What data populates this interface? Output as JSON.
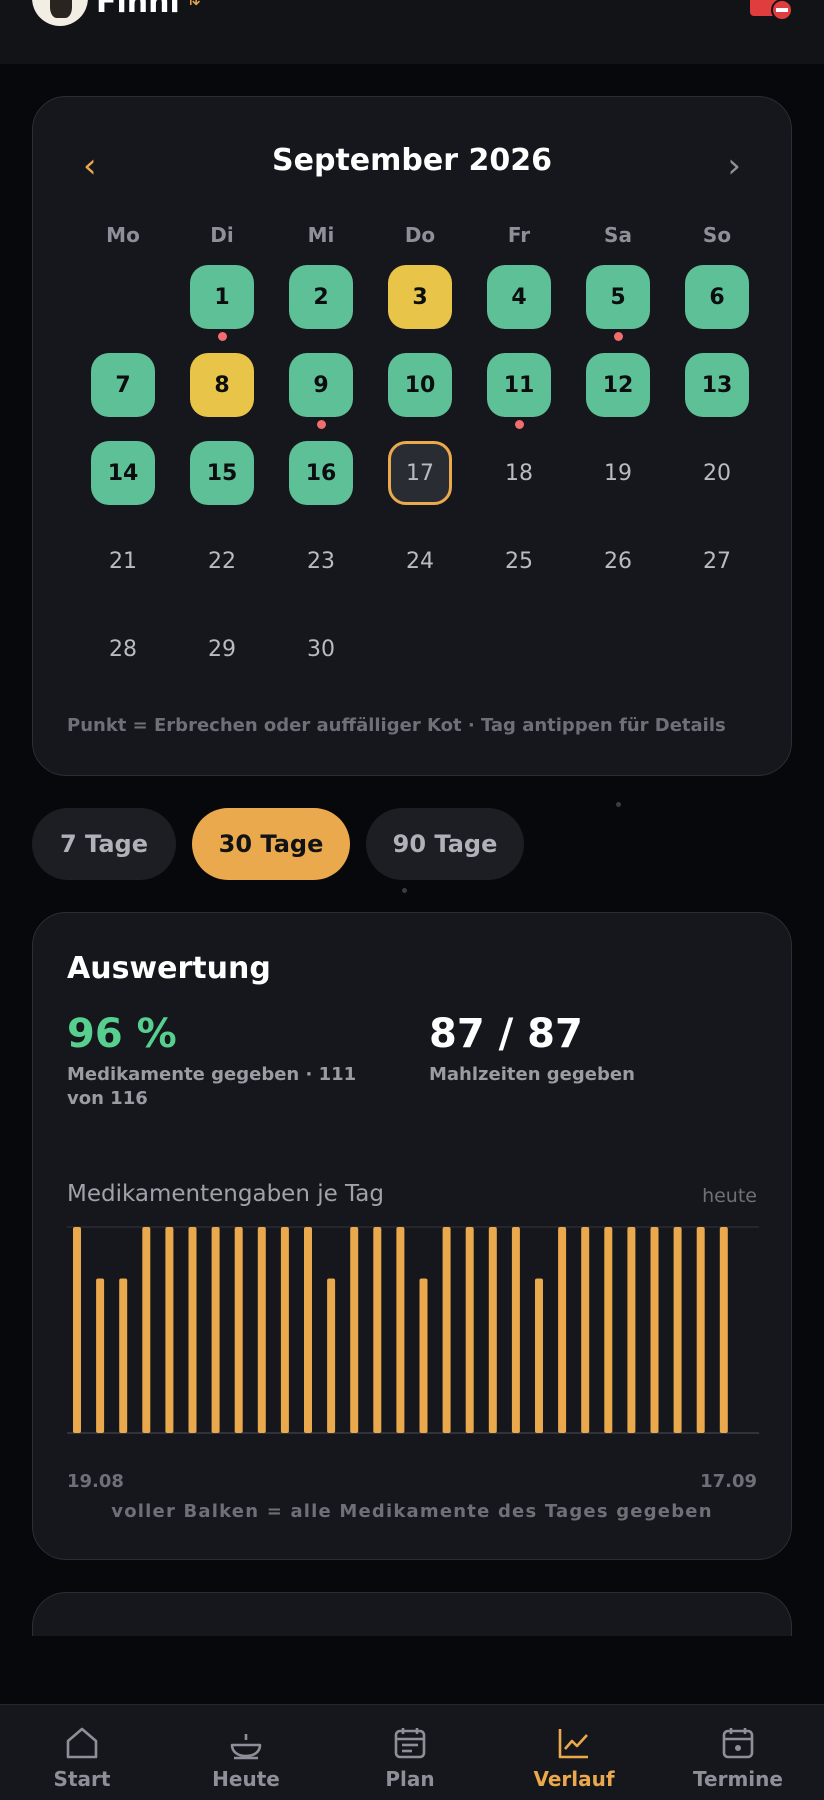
{
  "header": {
    "pet_name": "Finni",
    "swap_icon": "swap-arrows-icon",
    "alert_icon": "alert-icon"
  },
  "calendar": {
    "title": "September 2026",
    "weekdays": [
      "Mo",
      "Di",
      "Mi",
      "Do",
      "Fr",
      "Sa",
      "So"
    ],
    "days": [
      {
        "label": "1",
        "status": "green",
        "dot": true
      },
      {
        "label": "2",
        "status": "green",
        "dot": false
      },
      {
        "label": "3",
        "status": "yellow",
        "dot": false
      },
      {
        "label": "4",
        "status": "green",
        "dot": false
      },
      {
        "label": "5",
        "status": "green",
        "dot": true
      },
      {
        "label": "6",
        "status": "green",
        "dot": false
      },
      {
        "label": "7",
        "status": "green",
        "dot": false
      },
      {
        "label": "8",
        "status": "yellow",
        "dot": false
      },
      {
        "label": "9",
        "status": "green",
        "dot": true
      },
      {
        "label": "10",
        "status": "green",
        "dot": false
      },
      {
        "label": "11",
        "status": "green",
        "dot": true
      },
      {
        "label": "12",
        "status": "green",
        "dot": false
      },
      {
        "label": "13",
        "status": "green",
        "dot": false
      },
      {
        "label": "14",
        "status": "green",
        "dot": false
      },
      {
        "label": "15",
        "status": "green",
        "dot": false
      },
      {
        "label": "16",
        "status": "green",
        "dot": false
      },
      {
        "label": "17",
        "status": "today",
        "dot": false
      },
      {
        "label": "18",
        "status": "none",
        "dot": false
      },
      {
        "label": "19",
        "status": "none",
        "dot": false
      },
      {
        "label": "20",
        "status": "none",
        "dot": false
      },
      {
        "label": "21",
        "status": "none",
        "dot": false
      },
      {
        "label": "22",
        "status": "none",
        "dot": false
      },
      {
        "label": "23",
        "status": "none",
        "dot": false
      },
      {
        "label": "24",
        "status": "none",
        "dot": false
      },
      {
        "label": "25",
        "status": "none",
        "dot": false
      },
      {
        "label": "26",
        "status": "none",
        "dot": false
      },
      {
        "label": "27",
        "status": "none",
        "dot": false
      },
      {
        "label": "28",
        "status": "none",
        "dot": false
      },
      {
        "label": "29",
        "status": "none",
        "dot": false
      },
      {
        "label": "30",
        "status": "none",
        "dot": false
      }
    ],
    "first_weekday_offset": 1,
    "note": "Punkt = Erbrechen oder auffälliger Kot · Tag antippen für Details"
  },
  "ranges": {
    "items": [
      "7 Tage",
      "30 Tage",
      "90 Tage"
    ],
    "selected": "30 Tage"
  },
  "stats": {
    "title": "Auswertung",
    "med_percent": "96 %",
    "med_sub": "Medikamente gegeben · 111 von 116",
    "meals_value": "87 / 87",
    "meals_sub": "Mahlzeiten gegeben",
    "chart_title": "Medikamentengaben je Tag",
    "chart_right_label": "heute",
    "axis_start": "19.08",
    "axis_end": "17.09",
    "chart_note": "voller Balken = alle Medikamente des Tages gegeben"
  },
  "chart_data": {
    "type": "bar",
    "title": "Medikamentengaben je Tag",
    "x_start": "19.08",
    "x_end": "17.09",
    "values": [
      1,
      0.75,
      0.75,
      1,
      1,
      1,
      1,
      1,
      1,
      1,
      1,
      0.75,
      1,
      1,
      1,
      0.75,
      1,
      1,
      1,
      1,
      0.75,
      1,
      1,
      1,
      1,
      1,
      1,
      1,
      1
    ],
    "ylim": [
      0,
      1
    ],
    "color": "#e9a94c"
  },
  "nav": {
    "items": [
      {
        "label": "Start",
        "icon": "home-icon"
      },
      {
        "label": "Heute",
        "icon": "bowl-icon"
      },
      {
        "label": "Plan",
        "icon": "plan-icon"
      },
      {
        "label": "Verlauf",
        "icon": "chart-icon"
      },
      {
        "label": "Termine",
        "icon": "calendar-icon"
      }
    ],
    "active": "Verlauf"
  },
  "colors": {
    "accent": "#e9a94c",
    "green": "#5ec096",
    "yellow": "#e8c548",
    "dot": "#f26d6d",
    "success_text": "#57cf8f"
  }
}
